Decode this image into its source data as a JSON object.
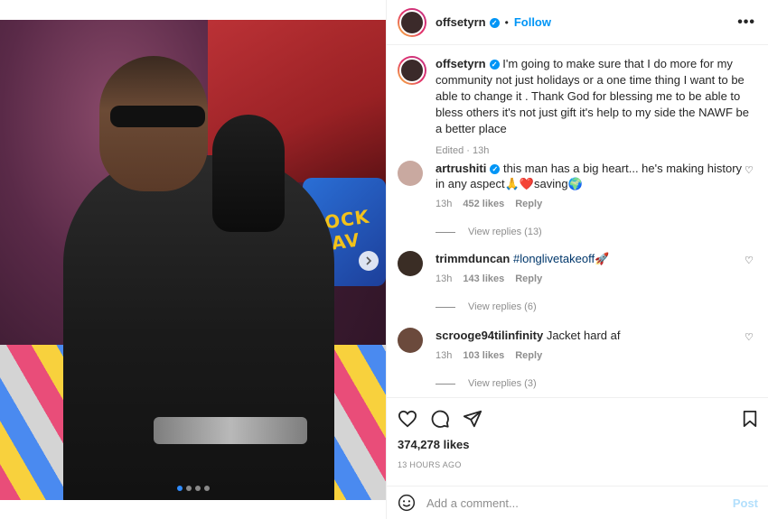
{
  "post": {
    "username": "offsetyrn",
    "follow_label": "Follow",
    "separator": "•",
    "caption": "I'm going to make sure that I do more for my community not just holidays or a one time thing I want to be able to change it . Thank God for blessing me to be able to bless others it's not just gift it's help to my side the NAWF be a better place",
    "edited": "Edited · 13h",
    "likes": "374,278 likes",
    "time_ago": "13 HOURS AGO",
    "media_sign_text": "HOCK WAV",
    "carousel": {
      "count": 4,
      "active_index": 0
    }
  },
  "comments": [
    {
      "username": "artrushiti",
      "verified": true,
      "text": "this man has a big heart... he's making history in any aspect🙏❤️saving🌍",
      "time": "13h",
      "likes": "452 likes",
      "reply": "Reply",
      "view_replies": "View replies (13)",
      "avatar_color": "#c9a9a0"
    },
    {
      "username": "trimmduncan",
      "verified": false,
      "text": "#longlivetakeoff🚀",
      "time": "13h",
      "likes": "143 likes",
      "reply": "Reply",
      "view_replies": "View replies (6)",
      "avatar_color": "#3a2d25"
    },
    {
      "username": "scrooge94tilinfinity",
      "verified": false,
      "text": "Jacket hard af",
      "time": "13h",
      "likes": "103 likes",
      "reply": "Reply",
      "view_replies": "View replies (3)",
      "avatar_color": "#6b4a3c"
    }
  ],
  "add_comment": {
    "placeholder": "Add a comment...",
    "post_label": "Post"
  },
  "colors": {
    "accent": "#0095f6",
    "text": "#262626",
    "muted": "#8e8e8e",
    "post_disabled": "#b2dffc"
  },
  "icons": [
    "verified-badge-icon",
    "more-options-icon",
    "heart-icon",
    "comment-icon",
    "share-icon",
    "save-icon",
    "emoji-icon",
    "next-arrow-icon"
  ]
}
